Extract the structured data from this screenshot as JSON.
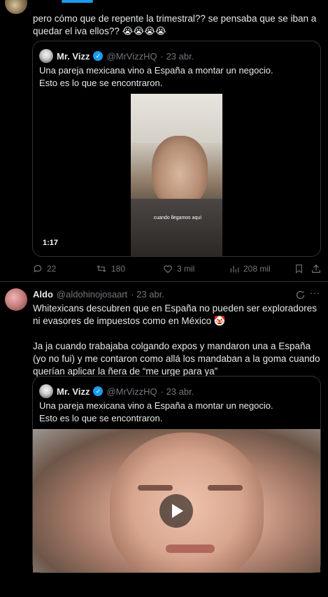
{
  "tweet1": {
    "text": "pero cómo que de repente la trimestral?? se pensaba que se iban a quedar el iva ellos?? 😭😭😭😭",
    "quote": {
      "name": "Mr. Vizz",
      "handle": "@MrVizzHQ",
      "date": "· 23 abr.",
      "text": "Una pareja mexicana vino a España a montar un negocio.\nEsto es lo que se encontraron.",
      "video_duration": "1:17",
      "caption_overlay": "cuando llegamos aquí"
    },
    "actions": {
      "replies": "22",
      "reposts": "180",
      "likes": "3 mil",
      "views": "208 mil"
    }
  },
  "tweet2": {
    "name": "Aldo",
    "handle": "@aldohinojosaart",
    "date": "· 23 abr.",
    "text": "Whitexicans descubren que en España no pueden ser exploradores ni evasores de impuestos como en México 🤡\n\nJa ja cuando trabajaba colgando expos y mandaron una a España (yo no fui) y me contaron como allá los mandaban a la goma cuando querían aplicar la ñera de “me urge para ya”",
    "quote": {
      "name": "Mr. Vizz",
      "handle": "@MrVizzHQ",
      "date": "· 23 abr.",
      "text": "Una pareja mexicana vino a España a montar un negocio.\nEsto es lo que se encontraron."
    }
  },
  "icons": {
    "reply": "reply-icon",
    "repost": "repost-icon",
    "like": "heart-icon",
    "views": "views-icon",
    "bookmark": "bookmark-icon",
    "share": "share-icon",
    "grok": "grok-icon",
    "more": "more-icon",
    "play": "play-icon",
    "verified": "verified-badge-icon"
  },
  "colors": {
    "background": "#000000",
    "text": "#e7e9ea",
    "muted": "#71767b",
    "accent": "#1d9bf0",
    "border": "#2f3336"
  }
}
